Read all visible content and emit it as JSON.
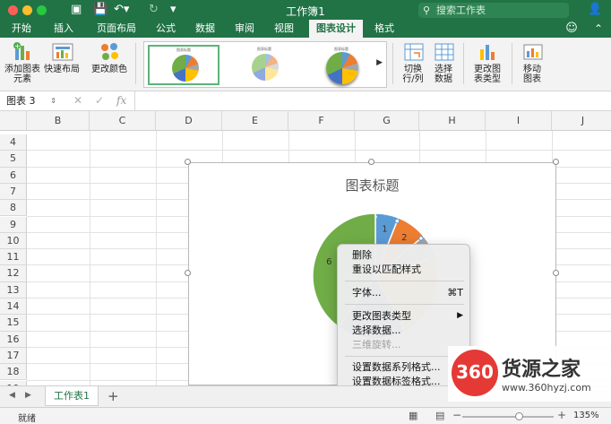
{
  "window": {
    "title": "工作簿1",
    "search_placeholder": "搜索工作表"
  },
  "quick_access": {
    "save_icon": "save-icon",
    "undo_icon": "undo-icon",
    "redo_icon": "redo-icon"
  },
  "tabs": [
    "开始",
    "插入",
    "页面布局",
    "公式",
    "数据",
    "审阅",
    "视图",
    "图表设计",
    "格式"
  ],
  "active_tab": "图表设计",
  "ribbon": {
    "add_element": "添加图表\n元素",
    "quick_layout": "快速布局",
    "change_colors": "更改颜色",
    "switch_row_col": "切换\n行/列",
    "select_data": "选择\n数据",
    "change_type": "更改图\n表类型",
    "move_chart": "移动\n图表",
    "gallery_title": "图表标题"
  },
  "formula_bar": {
    "name_box": "图表 3",
    "fx": "fx",
    "value": ""
  },
  "columns": [
    "B",
    "C",
    "D",
    "E",
    "F",
    "G",
    "H",
    "I",
    "J"
  ],
  "rows": [
    "4",
    "5",
    "6",
    "7",
    "8",
    "9",
    "10",
    "11",
    "12",
    "13",
    "14",
    "15",
    "16",
    "17",
    "18",
    "19"
  ],
  "chart": {
    "title": "图表标题",
    "chart_data": {
      "type": "pie",
      "title": "图表标题",
      "categories": [
        "1",
        "2",
        "3",
        "4",
        "5",
        "6"
      ],
      "values": [
        6,
        8,
        6,
        22,
        18,
        40
      ],
      "data_labels": [
        "1",
        "2",
        "6"
      ],
      "colors": [
        "#5b9bd5",
        "#ed7d31",
        "#a5a5a5",
        "#ffc000",
        "#4472c4",
        "#70ad47"
      ]
    }
  },
  "context_menu": {
    "items": [
      {
        "label": "删除",
        "shortcut": "",
        "disabled": false
      },
      {
        "label": "重设以匹配样式",
        "shortcut": "",
        "disabled": false
      },
      {
        "label": "字体...",
        "shortcut": "⌘T",
        "disabled": false
      },
      {
        "label": "更改图表类型",
        "shortcut": "▶",
        "disabled": false
      },
      {
        "label": "选择数据...",
        "shortcut": "",
        "disabled": false
      },
      {
        "label": "三维旋转...",
        "shortcut": "",
        "disabled": true
      },
      {
        "label": "设置数据系列格式...",
        "shortcut": "",
        "disabled": false
      },
      {
        "label": "设置数据标签格式...",
        "shortcut": "",
        "disabled": false
      }
    ]
  },
  "sheet": {
    "tab_name": "工作表1",
    "add_label": "+"
  },
  "status": {
    "ready": "就绪",
    "zoom": "135%",
    "zoom_level": 0.62
  },
  "watermark": {
    "logo": "360",
    "brand": "货源之家",
    "url": "www.360hyzj.com"
  }
}
